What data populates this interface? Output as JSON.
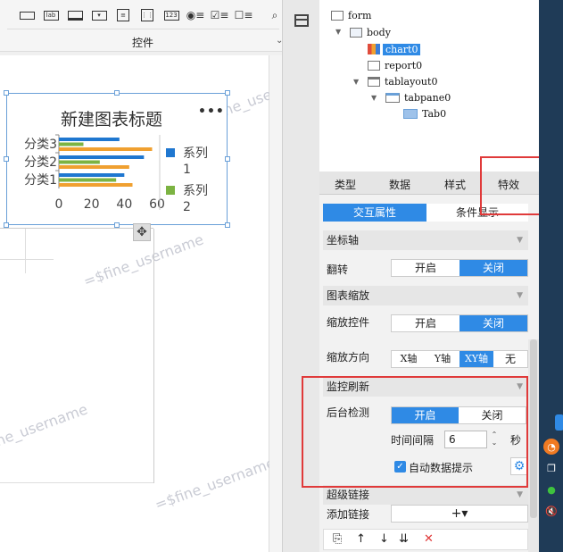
{
  "toolbar": {
    "section_label": "控件",
    "tools": [
      "text-field-icon",
      "label-icon",
      "button-icon",
      "dropdown-icon",
      "form-icon",
      "table-icon",
      "number-icon",
      "radio-group-icon",
      "checkbox-group-icon",
      "more-icon"
    ],
    "label_tool_text": "lab",
    "number_tool_text": "123"
  },
  "chart": {
    "title": "新建图表标题",
    "more": "•••",
    "chart_data": {
      "type": "bar",
      "orientation": "horizontal",
      "categories": [
        "分类1",
        "分类2",
        "分类3"
      ],
      "series": [
        {
          "name": "系列1",
          "values": [
            40,
            52,
            37
          ],
          "color": "#1f77d0"
        },
        {
          "name": "系列2",
          "values": [
            35,
            25,
            15
          ],
          "color": "#7cb342"
        },
        {
          "name": "",
          "values": [
            45,
            43,
            57
          ],
          "color": "#f0a030"
        }
      ],
      "xticks": [
        "0",
        "20",
        "40",
        "60"
      ],
      "xlim": [
        0,
        60
      ],
      "legend": {
        "position": "right",
        "labels": [
          "系列1",
          "系列2"
        ]
      }
    }
  },
  "watermark": "=$fine_username",
  "tree": {
    "nodes": [
      {
        "label": "form",
        "icon": "form-icon"
      },
      {
        "label": "body",
        "icon": "body-icon"
      },
      {
        "label": "chart0",
        "icon": "chart-icon"
      },
      {
        "label": "report0",
        "icon": "report-icon"
      },
      {
        "label": "tablayout0",
        "icon": "tablayout-icon"
      },
      {
        "label": "tabpane0",
        "icon": "tabpane-icon"
      },
      {
        "label": "Tab0",
        "icon": "tab-icon"
      }
    ]
  },
  "panel": {
    "tabs": [
      "类型",
      "数据",
      "样式",
      "特效"
    ],
    "subtabs": [
      "交互属性",
      "条件显示"
    ],
    "axis_section": "坐标轴",
    "flip_label": "翻转",
    "on_label": "开启",
    "off_label": "关闭",
    "zoom_section": "图表缩放",
    "zoom_control_label": "缩放控件",
    "zoom_direction_label": "缩放方向",
    "zoom_directions": [
      "X轴",
      "Y轴",
      "XY轴",
      "无"
    ],
    "monitor_section": "监控刷新",
    "background_check_label": "后台检测",
    "interval_label": "时间间隔",
    "interval_value": "6",
    "interval_unit": "秒",
    "auto_data_tip": "自动数据提示",
    "hyperlink_section": "超级链接",
    "add_link_label": "添加链接",
    "add_link_button": "+▾"
  }
}
